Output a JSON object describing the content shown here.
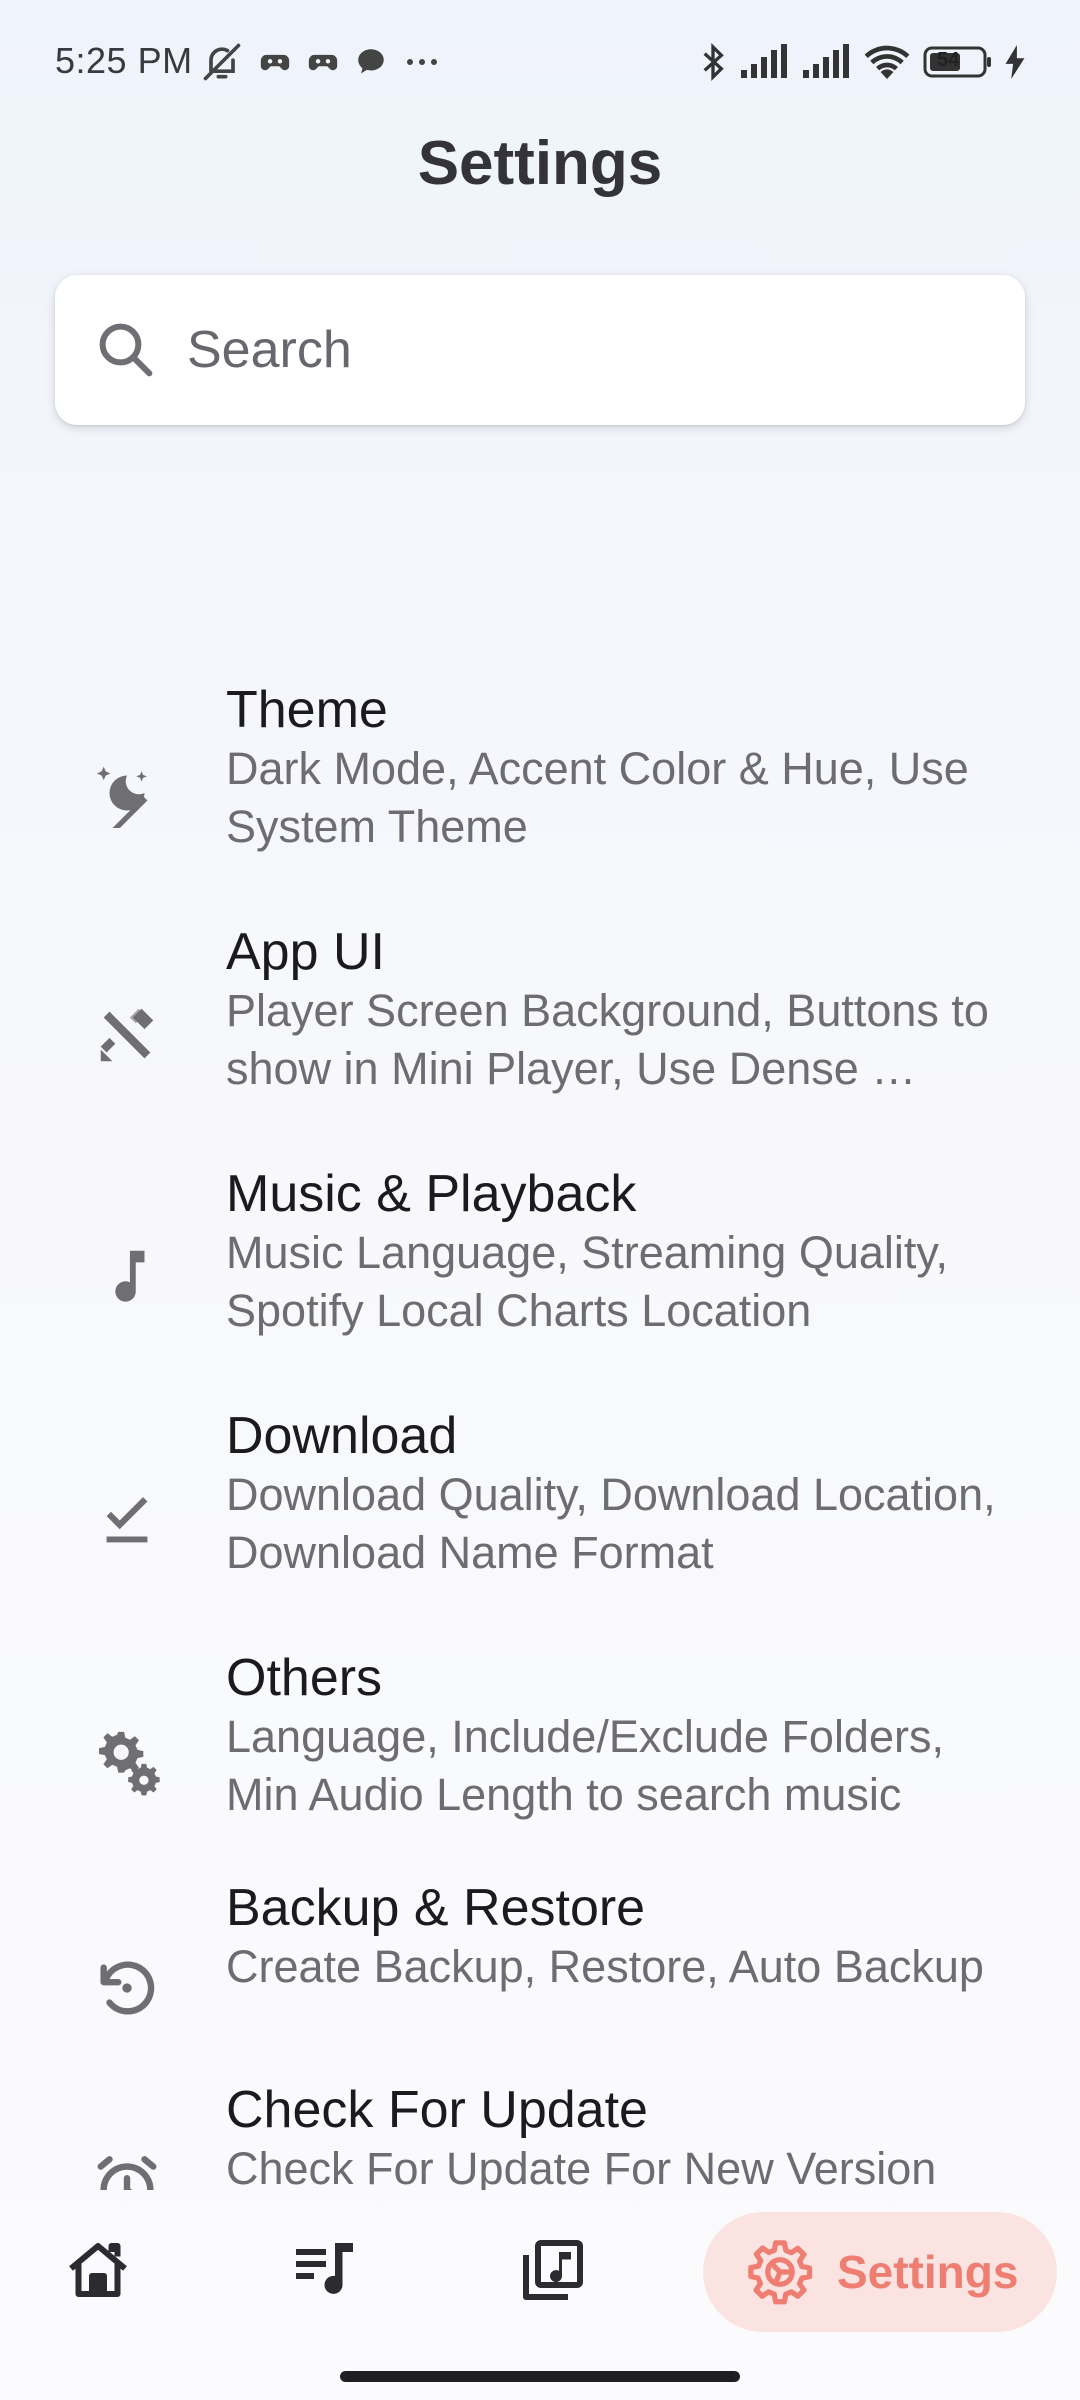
{
  "status_bar": {
    "time": "5:25 PM",
    "battery": "54",
    "icons": [
      "mute-icon",
      "game-icon",
      "game-icon",
      "chat-icon",
      "more-dots-icon",
      "bluetooth-icon",
      "signal-icon",
      "signal-icon",
      "wifi-icon",
      "battery-icon",
      "charging-icon"
    ]
  },
  "header": {
    "title": "Settings"
  },
  "search": {
    "placeholder": "Search",
    "value": ""
  },
  "settings": [
    {
      "icon": "theme-icon",
      "title": "Theme",
      "subtitle": "Dark Mode, Accent Color & Hue, Use System Theme"
    },
    {
      "icon": "design-tools-icon",
      "title": "App UI",
      "subtitle": "Player Screen Background, Buttons to show in Mini Player, Use Dense …"
    },
    {
      "icon": "music-note-icon",
      "title": "Music & Playback",
      "subtitle": "Music Language, Streaming Quality, Spotify Local Charts Location"
    },
    {
      "icon": "download-done-icon",
      "title": "Download",
      "subtitle": "Download Quality, Download Location, Download Name Format"
    },
    {
      "icon": "gears-icon",
      "title": "Others",
      "subtitle": "Language, Include/Exclude Folders, Min Audio Length to search music"
    },
    {
      "icon": "restore-icon",
      "title": "Backup & Restore",
      "subtitle": "Create Backup, Restore, Auto Backup"
    },
    {
      "icon": "alarm-clock-icon",
      "title": "Check For Update",
      "subtitle": "Check For Update For New Version"
    }
  ],
  "bottom_nav": {
    "items": [
      {
        "icon": "home-icon"
      },
      {
        "icon": "queue-music-icon"
      },
      {
        "icon": "library-music-icon"
      }
    ],
    "active": {
      "icon": "settings-icon",
      "label": "Settings"
    }
  },
  "colors": {
    "accent": "#ee7e72",
    "accent_bg": "#fbe3e1",
    "icon_gray": "#6e6e73"
  }
}
